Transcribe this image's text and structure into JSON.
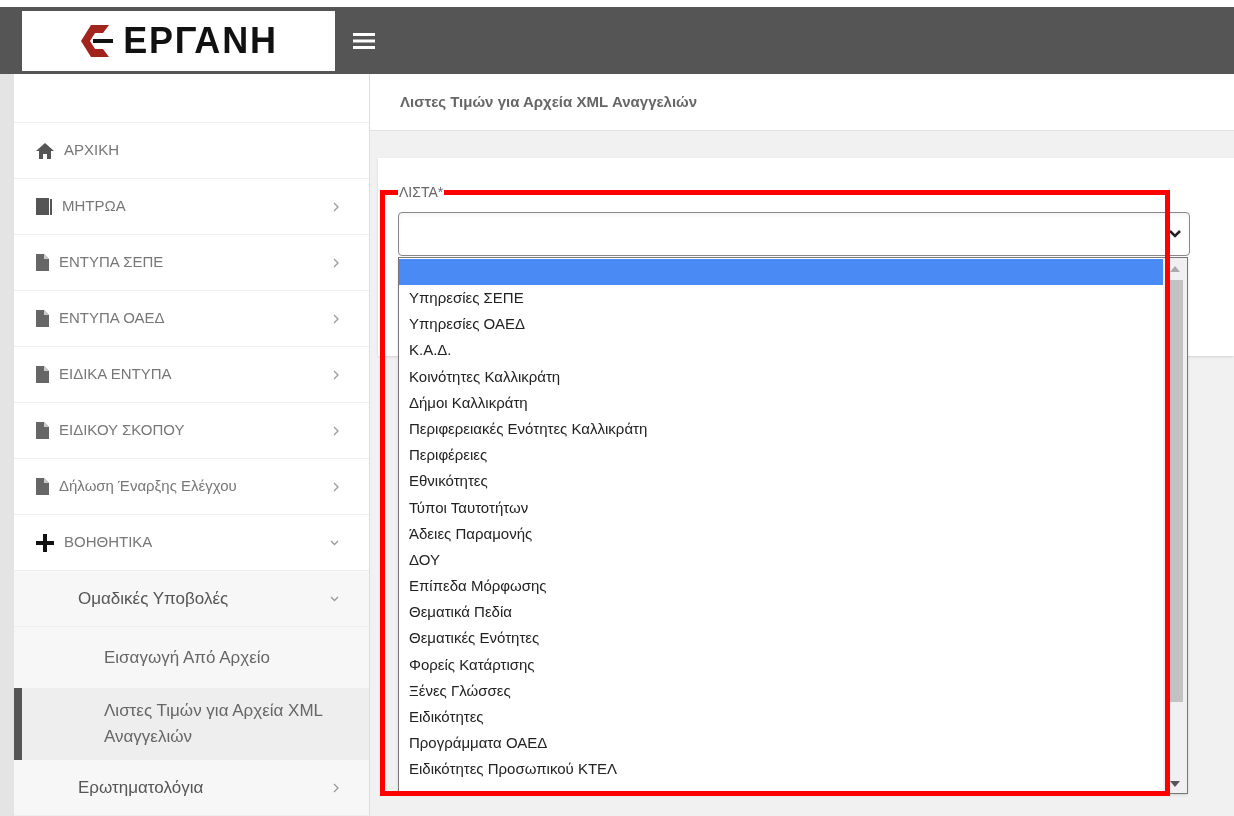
{
  "header": {
    "logo_text": "ΕΡΓΑΝΗ"
  },
  "sidebar": {
    "items": [
      {
        "label": "ΑΡΧΙΚΗ",
        "kind": "home"
      },
      {
        "label": "ΜΗΤΡΩΑ",
        "kind": "book",
        "expanded": false
      },
      {
        "label": "ΕΝΤΥΠΑ ΣΕΠΕ",
        "kind": "file",
        "expanded": false
      },
      {
        "label": "ΕΝΤΥΠΑ ΟΑΕΔ",
        "kind": "file",
        "expanded": false
      },
      {
        "label": "ΕΙΔΙΚΑ ΕΝΤΥΠΑ",
        "kind": "file",
        "expanded": false
      },
      {
        "label": "ΕΙΔΙΚΟΥ ΣΚΟΠΟΥ",
        "kind": "file",
        "expanded": false
      },
      {
        "label": "Δήλωση Έναρξης Ελέγχου",
        "kind": "file",
        "expanded": false
      },
      {
        "label": "ΒΟΗΘΗΤΙΚΑ",
        "kind": "plus",
        "expanded": true,
        "children": [
          {
            "label": "Ομαδικές Υποβολές",
            "expanded": true,
            "children": [
              {
                "label": "Εισαγωγή Από Αρχείο",
                "selected": false
              },
              {
                "label": "Λιστες Τιμών για Αρχεία XML Αναγγελιών",
                "selected": true
              }
            ]
          },
          {
            "label": "Ερωτηματολόγια",
            "expanded": false
          }
        ]
      }
    ]
  },
  "breadcrumb": "Λιστες Τιμών για Αρχεία XML Αναγγελιών",
  "form": {
    "label": "ΛΙΣΤΑ*",
    "dropdown": {
      "expanded": true,
      "options": [
        {
          "selected": true
        },
        {
          "label": "Υπηρεσίες ΣΕΠΕ",
          "selected": false
        },
        {
          "label": "Υπηρεσίες ΟΑΕΔ",
          "selected": false
        },
        {
          "label": "Κ.Α.Δ.",
          "selected": false
        },
        {
          "label": "Κοινότητες Καλλικράτη",
          "selected": false
        },
        {
          "label": "Δήμοι Καλλικράτη",
          "selected": false
        },
        {
          "label": "Περιφερειακές Ενότητες Καλλικράτη",
          "selected": false
        },
        {
          "label": "Περιφέρειες",
          "selected": false
        },
        {
          "label": "Εθνικότητες",
          "selected": false
        },
        {
          "label": "Τύποι Ταυτοτήτων",
          "selected": false
        },
        {
          "label": "Άδειες Παραμονής",
          "selected": false
        },
        {
          "label": "ΔΟΥ",
          "selected": false
        },
        {
          "label": "Επίπεδα Μόρφωσης",
          "selected": false
        },
        {
          "label": "Θεματικά Πεδία",
          "selected": false
        },
        {
          "label": "Θεματικές Ενότητες",
          "selected": false
        },
        {
          "label": "Φορείς Κατάρτισης",
          "selected": false
        },
        {
          "label": "Ξένες Γλώσσες",
          "selected": false
        },
        {
          "label": "Ειδικότητες",
          "selected": false
        },
        {
          "label": "Προγράμματα ΟΑΕΔ",
          "selected": false
        },
        {
          "label": "Ειδικότητες Προσωπικού ΚΤΕΛ",
          "selected": false
        }
      ]
    }
  },
  "annotation": {
    "kind": "frame"
  }
}
